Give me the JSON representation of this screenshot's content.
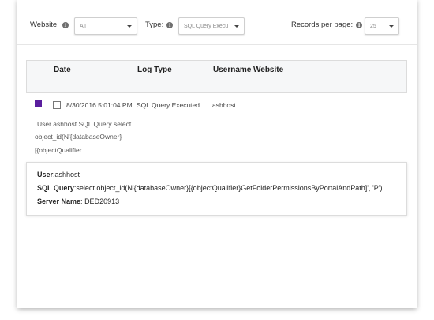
{
  "filters": {
    "website_label": "Website:",
    "website_value": "All",
    "type_label": "Type:",
    "type_value": "SQL Query Execu",
    "records_label": "Records per page:",
    "records_value": "25"
  },
  "table": {
    "columns": [
      "Date",
      "Log Type",
      "Username",
      "Website"
    ],
    "row": {
      "date": "8/30/2016 5:01:04 PM",
      "log_type": "SQL Query Executed",
      "username": "ashhost",
      "color": "#5a1e9e",
      "preview_lines": [
        "User ashhost SQL Query select",
        "object_id(N'{databaseOwner}",
        "[{objectQualifier"
      ]
    }
  },
  "detail": {
    "user_label": "User",
    "user_value": "ashhost",
    "sql_label": "SQL Query",
    "sql_value": "select object_id(N'{databaseOwner}[{objectQualifier}GetFolderPermissionsByPortalAndPath]', 'P')",
    "server_label": "Server Name",
    "server_value": "DED20913"
  },
  "icons": {
    "info": "i"
  }
}
